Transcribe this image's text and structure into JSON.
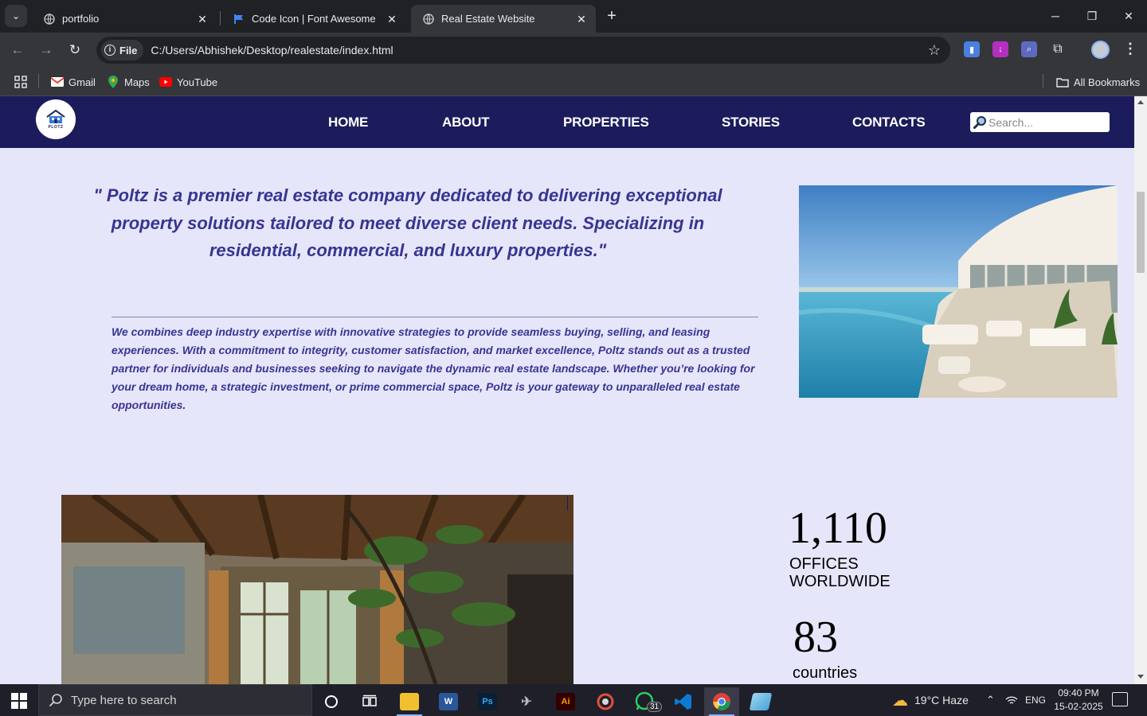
{
  "browser": {
    "tabs": [
      {
        "title": "portfolio",
        "active": false
      },
      {
        "title": "Code Icon | Font Awesome",
        "active": false
      },
      {
        "title": "Real Estate Website",
        "active": true
      }
    ],
    "address": {
      "scheme_label": "File",
      "url": "C:/Users/Abhishek/Desktop/realestate/index.html"
    },
    "bookmarks": [
      {
        "label": "Gmail",
        "icon": "gmail-icon"
      },
      {
        "label": "Maps",
        "icon": "maps-icon"
      },
      {
        "label": "YouTube",
        "icon": "youtube-icon"
      }
    ],
    "all_bookmarks_label": "All Bookmarks"
  },
  "site": {
    "logo_text": "PLOTZ",
    "nav": [
      "HOME",
      "ABOUT",
      "PROPERTIES",
      "STORIES",
      "CONTACTS"
    ],
    "search_placeholder": "Search...",
    "quote": "\" Poltz is a premier real estate company dedicated to delivering exceptional property solutions tailored to meet diverse client needs. Specializing in residential, commercial, and luxury properties.\"",
    "about": "We combines deep industry expertise with innovative strategies to provide seamless buying, selling, and leasing experiences. With a commitment to integrity, customer satisfaction, and market excellence, Poltz stands out as a trusted partner for individuals and businesses seeking to navigate the dynamic real estate landscape. Whether you’re looking for your dream home, a strategic investment, or prime commercial space, Poltz is your gateway to unparalleled real estate opportunities.",
    "stats": [
      {
        "number": "1,110",
        "label_line1": "OFFICES",
        "label_line2": "WORLDWIDE"
      },
      {
        "number": "83",
        "label_line1": "countries"
      }
    ]
  },
  "taskbar": {
    "search_placeholder": "Type here to search",
    "whatsapp_badge": "31",
    "weather": "19°C  Haze",
    "language": "ENG",
    "time": "09:40 PM",
    "date": "15-02-2025"
  },
  "colors": {
    "nav_bg": "#1c1b5c",
    "page_bg": "#e6e6fb",
    "text_accent": "#363592"
  }
}
